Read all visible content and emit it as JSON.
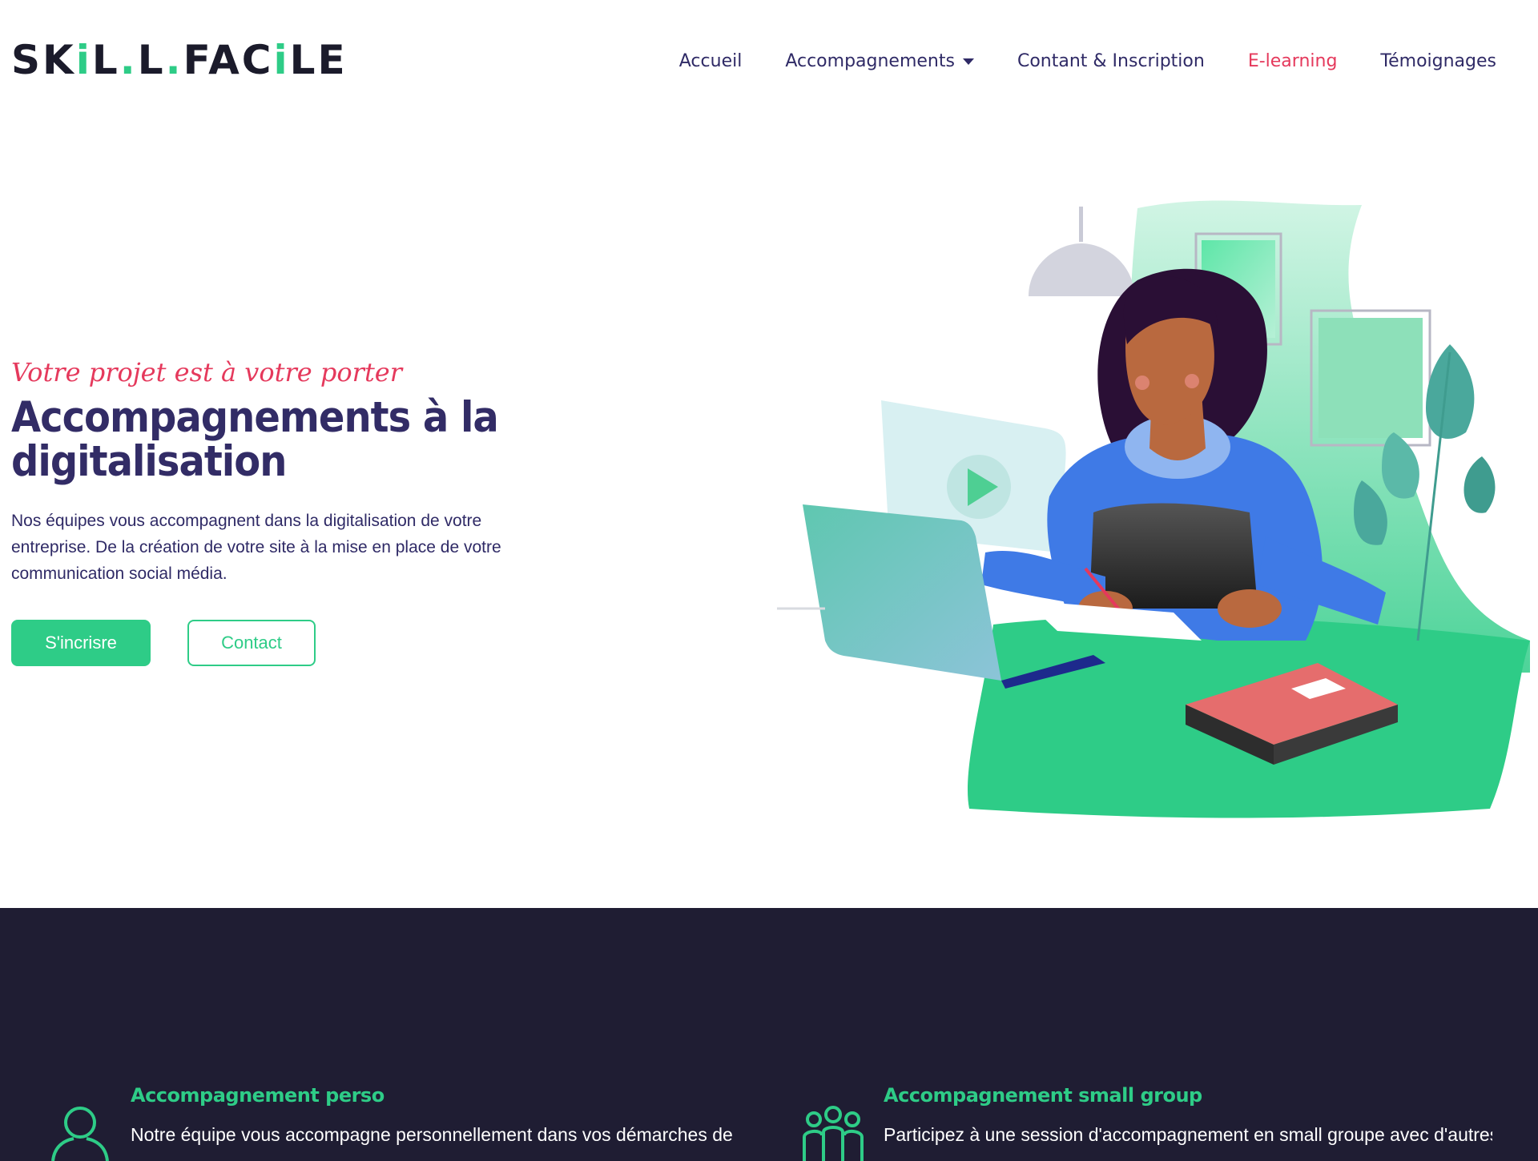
{
  "brand": {
    "logo_text": "SKILLFACILE",
    "accent": "#2ecc87",
    "highlight": "#e5395c",
    "navy": "#2f2a66",
    "dark_bg": "#1f1d33"
  },
  "nav": {
    "items": [
      {
        "label": "Accueil"
      },
      {
        "label": "Accompagnements"
      },
      {
        "label": "Contant & Inscription"
      },
      {
        "label": "E-learning"
      },
      {
        "label": "Témoignages"
      }
    ]
  },
  "hero": {
    "tagline": "Votre projet est à votre porter",
    "title": "Accompagnements à la digitalisation",
    "description": "Nos équipes vous accompagnent dans la digitalisation de votre entreprise. De la création de votre site à la mise en place de votre communication social média.",
    "primary_button": "S'incrisre",
    "secondary_button": "Contact"
  },
  "features": [
    {
      "title": "Accompagnement perso",
      "text": "Notre équipe vous accompagne personnellement dans vos démarches de",
      "icon": "person-icon"
    },
    {
      "title": "Accompagnement small group",
      "text": "Participez à une session d'accompagnement en small groupe avec d'autres",
      "icon": "group-icon"
    }
  ]
}
